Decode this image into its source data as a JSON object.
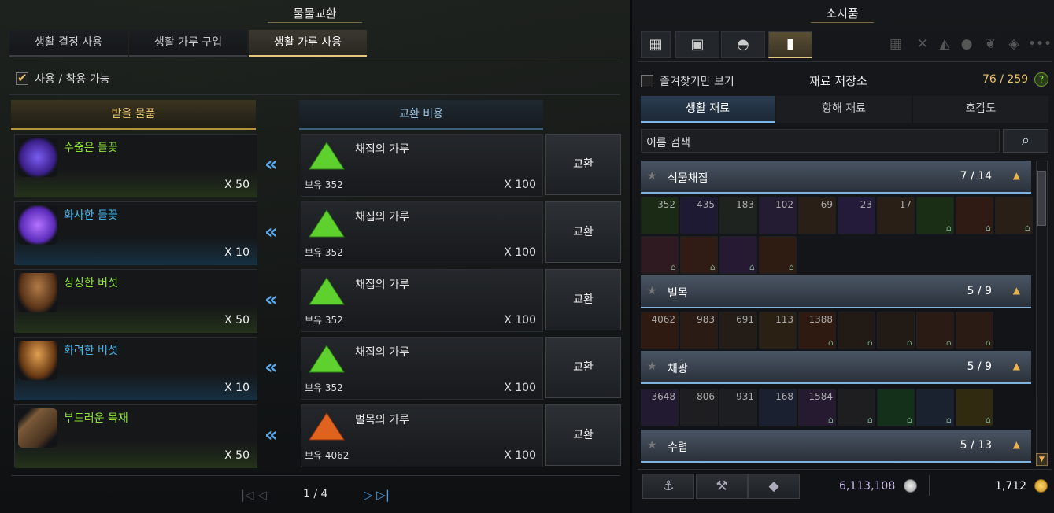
{
  "left": {
    "title": "물물교환",
    "tabs": [
      "생활 결정 사용",
      "생활 가루 구입",
      "생활 가루 사용"
    ],
    "filter_label": "사용 / 착용 가능",
    "header_get": "받을 물품",
    "header_cost": "교환 비용",
    "rows": [
      {
        "name": "수줍은 들꽃",
        "qty": "X 50",
        "cost_name": "채집의 가루",
        "own": "보유 352",
        "cost_qty": "X 100",
        "btn": "교환"
      },
      {
        "name": "화사한 들꽃",
        "qty": "X 10",
        "cost_name": "채집의 가루",
        "own": "보유 352",
        "cost_qty": "X 100",
        "btn": "교환"
      },
      {
        "name": "싱싱한 버섯",
        "qty": "X 50",
        "cost_name": "채집의 가루",
        "own": "보유 352",
        "cost_qty": "X 100",
        "btn": "교환"
      },
      {
        "name": "화려한 버섯",
        "qty": "X 10",
        "cost_name": "채집의 가루",
        "own": "보유 352",
        "cost_qty": "X 100",
        "btn": "교환"
      },
      {
        "name": "부드러운 목재",
        "qty": "X 50",
        "cost_name": "벌목의 가루",
        "own": "보유 4062",
        "cost_qty": "X 100",
        "btn": "교환"
      }
    ],
    "page": "1 / 4"
  },
  "right": {
    "title": "소지품",
    "favorites_label": "즐겨찾기만 보기",
    "storage_title": "재료 저장소",
    "capacity": "76 / 259",
    "help": "?",
    "subtabs": [
      "생활 재료",
      "항해 재료",
      "호감도"
    ],
    "search_placeholder": "이름 검색",
    "categories": [
      {
        "name": "식물채집",
        "count": "7  /  14",
        "slots": [
          "352",
          "435",
          "183",
          "102",
          "69",
          "23",
          "17"
        ]
      },
      {
        "name": "벌목",
        "count": "5  /  9",
        "slots": [
          "4062",
          "983",
          "691",
          "113",
          "1388"
        ]
      },
      {
        "name": "채광",
        "count": "5  /  9",
        "slots": [
          "3648",
          "806",
          "931",
          "168",
          "1584"
        ]
      },
      {
        "name": "수렵",
        "count": "5  /  13",
        "slots": []
      }
    ],
    "silver": "6,113,108",
    "gold": "1,712"
  },
  "colors": {
    "accent_gold": "#e8c46a",
    "accent_blue": "#7fb6e8",
    "green_name": "#8fe23a",
    "blue_name": "#46b8f0"
  }
}
